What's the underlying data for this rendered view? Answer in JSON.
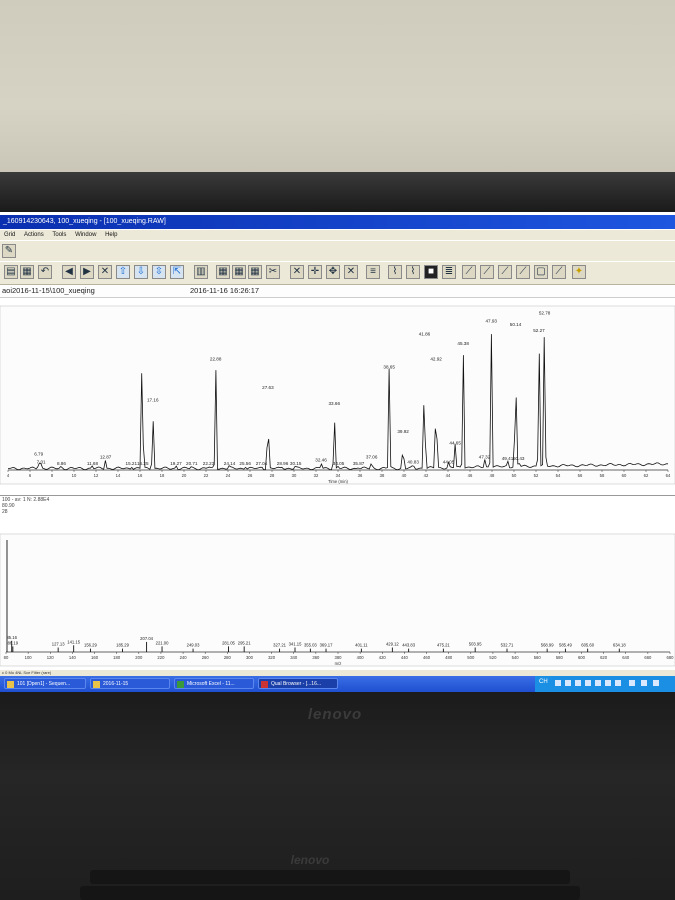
{
  "window": {
    "title": "_160914230643, 100_xueqing - [100_xueqing.RAW]"
  },
  "menu": [
    "Grid",
    "Actions",
    "Tools",
    "Window",
    "Help"
  ],
  "info": {
    "file_path": "aoi2016-11-15\\100_xueqing",
    "timestamp": "2016-11-16 16:26:17"
  },
  "spectrum_header": {
    "line1": "100 - av: 1  N: 2.88E4",
    "line2": "80.90",
    "line3": "28"
  },
  "status_bar": {
    "text": "c 0 Mo 4NL Sce Filter (rare)"
  },
  "taskbar": {
    "items": [
      {
        "label": "101 [Dpen1] - Sequen..."
      },
      {
        "label": "2016-11-15"
      },
      {
        "label": "Microsoft Excel - 11..."
      },
      {
        "label": "Qual Browser - [...16..."
      }
    ],
    "clock": "CH"
  },
  "bezel": {
    "brand": "lenovo"
  },
  "chart_data": [
    {
      "type": "line",
      "title": "",
      "xlabel": "Time (min)",
      "ylabel": "",
      "xlim": [
        4,
        64
      ],
      "x_ticks": [
        4,
        6,
        8,
        10,
        12,
        14,
        16,
        18,
        20,
        22,
        24,
        26,
        28,
        30,
        32,
        34,
        36,
        38,
        40,
        42,
        44,
        46,
        48,
        50,
        52,
        54,
        56,
        58,
        60,
        62,
        64
      ],
      "peaks": [
        {
          "x": 6.79,
          "y": 8,
          "label": "6.79"
        },
        {
          "x": 7.01,
          "y": 3,
          "label": "7.01"
        },
        {
          "x": 8.86,
          "y": 2,
          "label": "8.86"
        },
        {
          "x": 11.68,
          "y": 2,
          "label": "11.68"
        },
        {
          "x": 12.87,
          "y": 6,
          "label": "12.87"
        },
        {
          "x": 15.21,
          "y": 2,
          "label": "15.21"
        },
        {
          "x": 16.2,
          "y": 100,
          "label": ""
        },
        {
          "x": 16.25,
          "y": 2,
          "label": "16.25"
        },
        {
          "x": 17.16,
          "y": 42,
          "label": "17.16"
        },
        {
          "x": 19.27,
          "y": 2,
          "label": "19.27"
        },
        {
          "x": 20.71,
          "y": 2,
          "label": "20.71"
        },
        {
          "x": 22.23,
          "y": 2,
          "label": "22.23"
        },
        {
          "x": 22.88,
          "y": 68,
          "label": "22.88"
        },
        {
          "x": 24.14,
          "y": 2,
          "label": "24.14"
        },
        {
          "x": 25.56,
          "y": 2,
          "label": "25.56"
        },
        {
          "x": 27.04,
          "y": 2,
          "label": "27.04"
        },
        {
          "x": 27.63,
          "y": 50,
          "label": "27.63"
        },
        {
          "x": 28.96,
          "y": 2,
          "label": "28.96"
        },
        {
          "x": 30.15,
          "y": 2,
          "label": "30.15"
        },
        {
          "x": 32.46,
          "y": 4,
          "label": "32.46"
        },
        {
          "x": 33.66,
          "y": 40,
          "label": "33.66"
        },
        {
          "x": 34.05,
          "y": 2,
          "label": "34.05"
        },
        {
          "x": 35.87,
          "y": 2,
          "label": "35.87"
        },
        {
          "x": 37.06,
          "y": 6,
          "label": "37.06"
        },
        {
          "x": 38.65,
          "y": 63,
          "label": "38.65"
        },
        {
          "x": 39.92,
          "y": 22,
          "label": "39.92"
        },
        {
          "x": 40.83,
          "y": 3,
          "label": "40.83"
        },
        {
          "x": 41.86,
          "y": 84,
          "label": "41.86"
        },
        {
          "x": 42.92,
          "y": 68,
          "label": "42.92"
        },
        {
          "x": 44.05,
          "y": 3,
          "label": "44.05"
        },
        {
          "x": 44.65,
          "y": 15,
          "label": "44.65"
        },
        {
          "x": 45.38,
          "y": 78,
          "label": "45.38"
        },
        {
          "x": 47.32,
          "y": 6,
          "label": "47.32"
        },
        {
          "x": 47.93,
          "y": 92,
          "label": "47.93"
        },
        {
          "x": 49.41,
          "y": 5,
          "label": "49.41"
        },
        {
          "x": 50.14,
          "y": 90,
          "label": "50.14"
        },
        {
          "x": 50.43,
          "y": 5,
          "label": "50.43"
        },
        {
          "x": 52.27,
          "y": 86,
          "label": "52.27"
        },
        {
          "x": 52.78,
          "y": 97,
          "label": "52.78"
        }
      ]
    },
    {
      "type": "bar",
      "title": "",
      "xlabel": "m/z",
      "ylabel": "",
      "xlim": [
        80,
        680
      ],
      "x_ticks": [
        80,
        100,
        120,
        140,
        160,
        180,
        200,
        220,
        240,
        260,
        280,
        300,
        320,
        340,
        360,
        380,
        400,
        420,
        440,
        460,
        480,
        500,
        520,
        540,
        560,
        580,
        600,
        620,
        640,
        660,
        680
      ],
      "peaks": [
        {
          "x": 80.9,
          "y": 100,
          "label": ""
        },
        {
          "x": 85.16,
          "y": 10,
          "label": "85.16"
        },
        {
          "x": 86.19,
          "y": 5,
          "label": "86.19"
        },
        {
          "x": 127.13,
          "y": 4,
          "label": "127.13"
        },
        {
          "x": 141.15,
          "y": 6,
          "label": "141.15"
        },
        {
          "x": 156.29,
          "y": 3,
          "label": "156.29"
        },
        {
          "x": 185.29,
          "y": 3,
          "label": "185.29"
        },
        {
          "x": 207.04,
          "y": 9,
          "label": "207.04"
        },
        {
          "x": 221.0,
          "y": 5,
          "label": "221.00"
        },
        {
          "x": 249.03,
          "y": 3,
          "label": "249.03"
        },
        {
          "x": 281.05,
          "y": 5,
          "label": "281.05"
        },
        {
          "x": 295.21,
          "y": 5,
          "label": "295.21"
        },
        {
          "x": 327.21,
          "y": 3,
          "label": "327.21"
        },
        {
          "x": 341.15,
          "y": 4,
          "label": "341.15"
        },
        {
          "x": 355.03,
          "y": 3,
          "label": "355.03"
        },
        {
          "x": 369.17,
          "y": 3,
          "label": "369.17"
        },
        {
          "x": 401.11,
          "y": 3,
          "label": "401.11"
        },
        {
          "x": 429.12,
          "y": 4,
          "label": "429.12"
        },
        {
          "x": 443.83,
          "y": 3,
          "label": "443.83"
        },
        {
          "x": 475.21,
          "y": 3,
          "label": "475.21"
        },
        {
          "x": 503.95,
          "y": 4,
          "label": "503.95"
        },
        {
          "x": 532.71,
          "y": 3,
          "label": "532.71"
        },
        {
          "x": 568.99,
          "y": 3,
          "label": "568.99"
        },
        {
          "x": 585.49,
          "y": 3,
          "label": "585.49"
        },
        {
          "x": 605.6,
          "y": 3,
          "label": "605.60"
        },
        {
          "x": 634.18,
          "y": 3,
          "label": "634.18"
        }
      ]
    }
  ]
}
